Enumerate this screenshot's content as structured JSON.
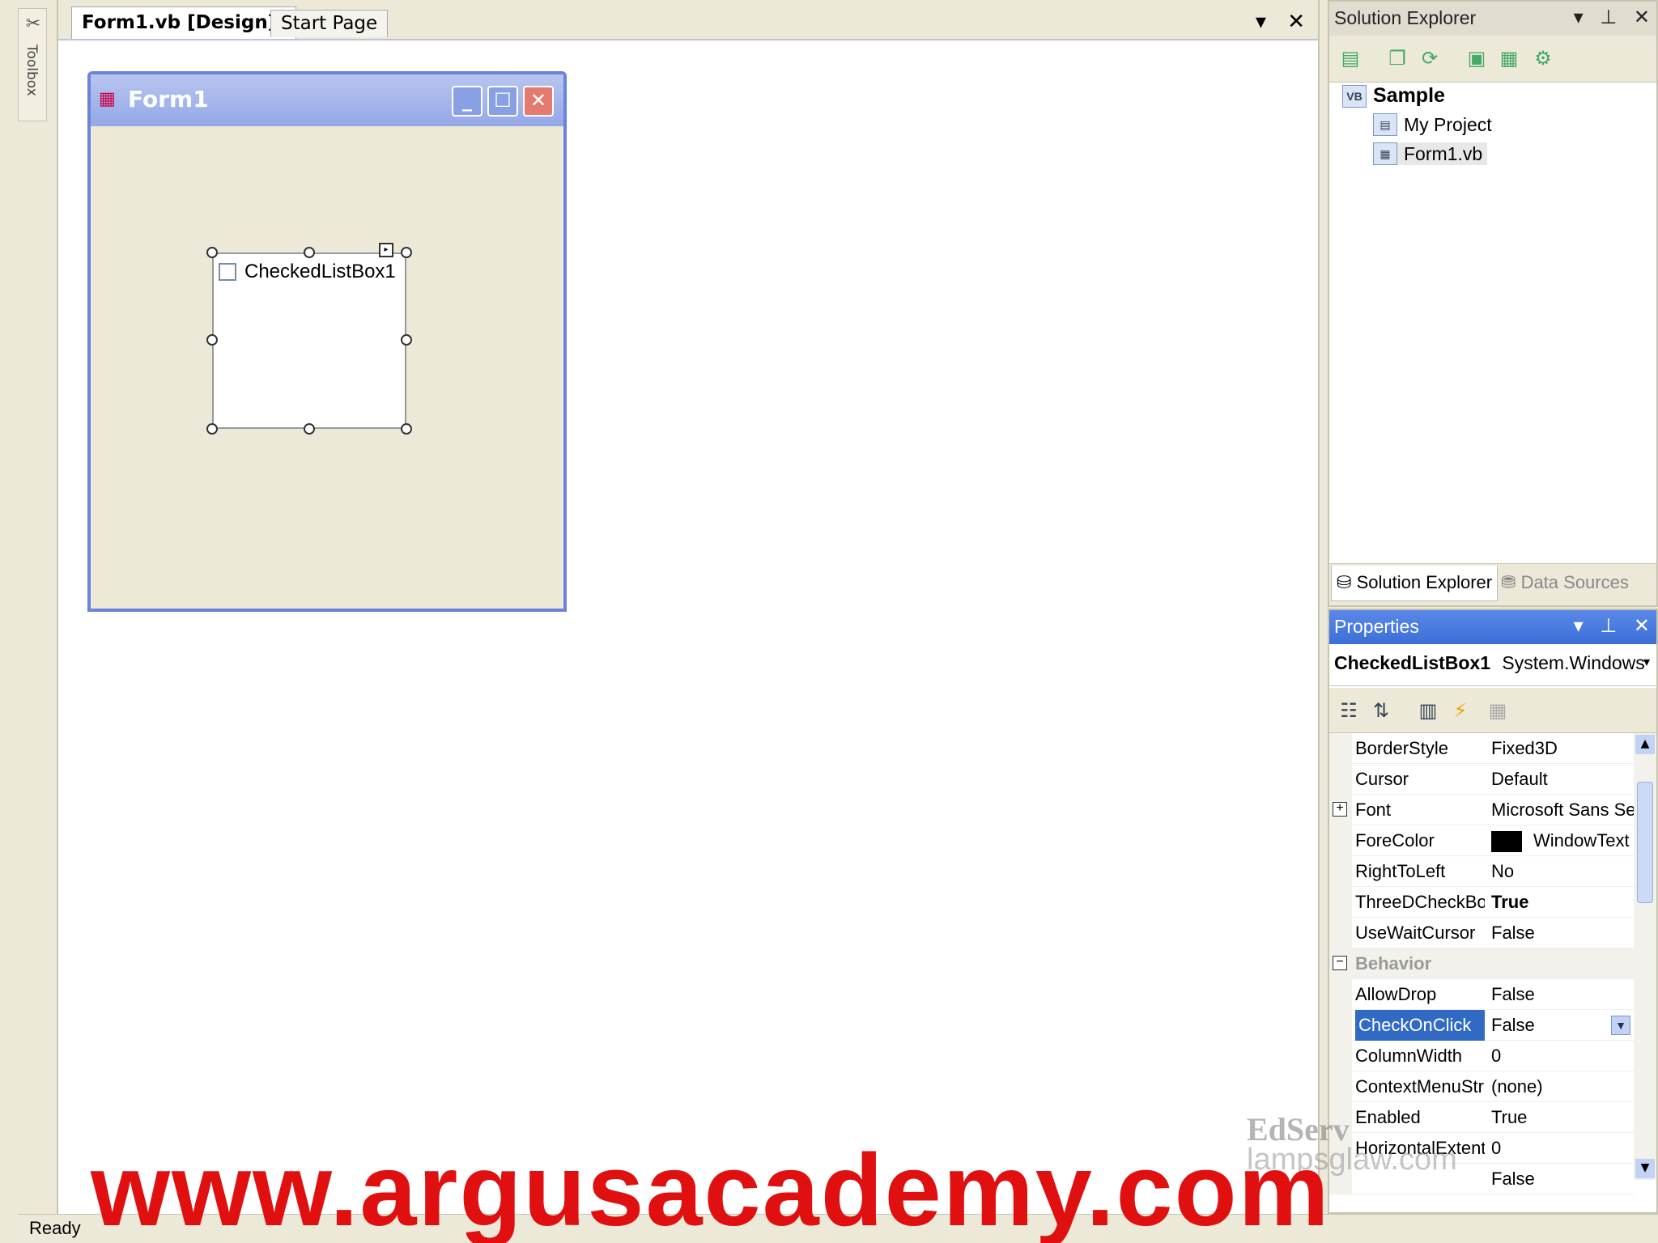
{
  "toolbox": {
    "label": "Toolbox"
  },
  "document": {
    "tabs": [
      {
        "label": "Form1.vb [Design]*"
      },
      {
        "label": "Start Page"
      }
    ]
  },
  "form": {
    "title": "Form1",
    "checked_list_box": {
      "item": "CheckedListBox1",
      "checked": false
    }
  },
  "solution_explorer": {
    "title": "Solution Explorer",
    "tree": {
      "root": "Sample",
      "children": [
        "My Project",
        "Form1.vb"
      ]
    },
    "bottom_tabs": [
      "Solution Explorer",
      "Data Sources"
    ]
  },
  "properties": {
    "title": "Properties",
    "object_name": "CheckedListBox1",
    "object_type": "System.Windows",
    "rows": [
      {
        "name": "BorderStyle",
        "value": "Fixed3D"
      },
      {
        "name": "Cursor",
        "value": "Default"
      },
      {
        "name": "Font",
        "value": "Microsoft Sans Se",
        "expander": "+"
      },
      {
        "name": "ForeColor",
        "value": "WindowText",
        "swatch": "#000000"
      },
      {
        "name": "RightToLeft",
        "value": "No"
      },
      {
        "name": "ThreeDCheckBo:",
        "value": "True",
        "bold": true
      },
      {
        "name": "UseWaitCursor",
        "value": "False"
      },
      {
        "name": "Behavior",
        "category": true,
        "expander": "−"
      },
      {
        "name": "AllowDrop",
        "value": "False"
      },
      {
        "name": "CheckOnClick",
        "value": "False",
        "selected": true
      },
      {
        "name": "ColumnWidth",
        "value": "0"
      },
      {
        "name": "ContextMenuStr",
        "value": "(none)"
      },
      {
        "name": "Enabled",
        "value": "True"
      },
      {
        "name": "HorizontalExtent",
        "value": "0"
      },
      {
        "name": "",
        "value": "False"
      }
    ]
  },
  "status": {
    "text": "Ready"
  },
  "watermarks": {
    "edserv": "EdServ",
    "lamp": "lampsglaw.com",
    "argus": "www.argusacademy.com"
  },
  "colors": {
    "selection": "#316ac5",
    "properties_header": "#3b6fd8",
    "watermark_red": "#e01010"
  }
}
